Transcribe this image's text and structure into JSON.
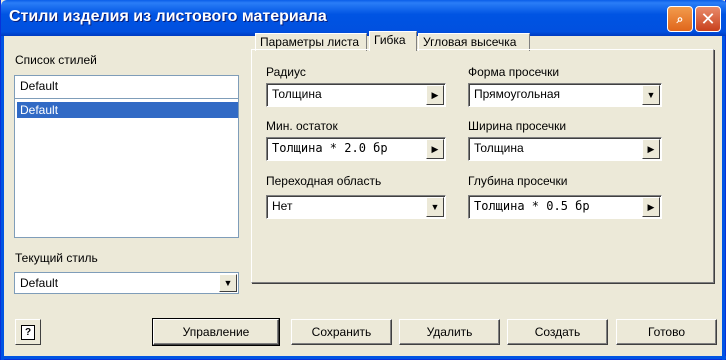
{
  "window": {
    "title": "Стили изделия из листового материала",
    "help_glyph": "⌕",
    "close_glyph": "✕"
  },
  "left": {
    "styles_list_label": "Список стилей",
    "name_field_value": "Default",
    "styles": [
      "Default"
    ],
    "selected_index": 0,
    "current_style_label": "Текущий стиль",
    "current_style_value": "Default"
  },
  "tabs": [
    {
      "label": "Параметры листа",
      "active": false
    },
    {
      "label": "Гибка",
      "active": true
    },
    {
      "label": "Угловая высечка",
      "active": false
    }
  ],
  "bend": {
    "radius_label": "Радиус",
    "radius_value": "Толщина",
    "min_rest_label": "Мин. остаток",
    "min_rest_value": "Толщина * 2.0 бр",
    "transition_label": "Переходная область",
    "transition_value": "Нет",
    "relief_shape_label": "Форма просечки",
    "relief_shape_value": "Прямоугольная",
    "relief_width_label": "Ширина просечки",
    "relief_width_value": "Толщина",
    "relief_depth_label": "Глубина просечки",
    "relief_depth_value": "Толщина * 0.5 бр"
  },
  "buttons": {
    "help": "?",
    "manage": "Управление",
    "save": "Сохранить",
    "delete": "Удалить",
    "create": "Создать",
    "done": "Готово"
  },
  "icons": {
    "arrow_right": "▶",
    "arrow_down": "▼"
  },
  "colors": {
    "titlebar": "#0054e3",
    "selection": "#316ac5",
    "face": "#ece9d8"
  }
}
